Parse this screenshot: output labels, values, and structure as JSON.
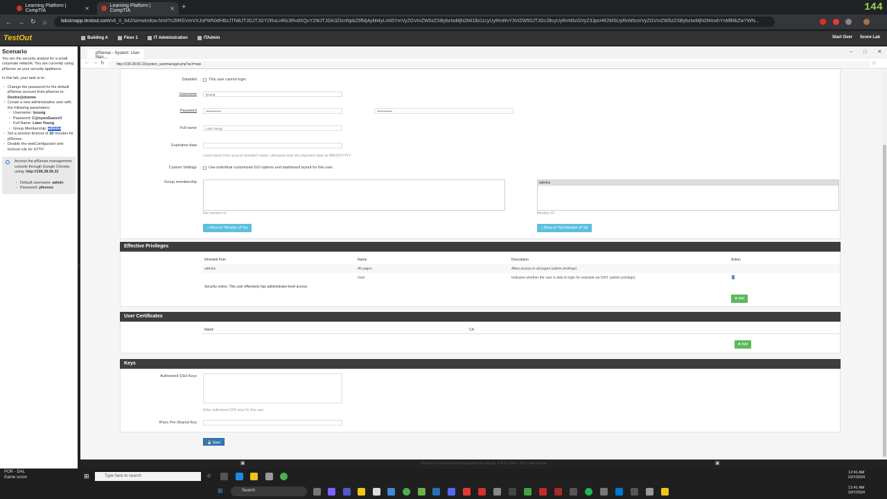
{
  "browser": {
    "tabs": [
      {
        "label": "Learning Platform | CompTIA"
      },
      {
        "label": "Learning Platform | CompTIA"
      }
    ],
    "url_domain": "labsimapp.testout.com",
    "url_rest": "/v6_0_642/simwindow.html?c2ltRGVmVXJsPWh0dHBzJTNBJTJGJTJGY2RuLnRic3RvdXQuY29tJTJGK3ZicnNpb25fMjAyMi4yLnN5YmVyZGVmZW5zZXBybzIwMjN2Mi1lbi11cyUyRmRvY3VtZW50JTJGc2ltcyUyRnN5cGVyZ3JpcHR2MSUyRnN5cmVyZGVmZW5zZXBybzIwMjN2MmxhYnMlMkZwYWN...",
    "game_score": "144"
  },
  "toolbar": {
    "logo": "TestOut",
    "items": [
      {
        "label": "Building A",
        "icon": "building-icon"
      },
      {
        "label": "Floor 1",
        "icon": "floor-icon"
      },
      {
        "label": "IT Administration",
        "icon": "room-icon"
      },
      {
        "label": "ITAdmin",
        "icon": "computer-icon"
      }
    ],
    "start_over": "Start Over",
    "score_lab": "Score Lab"
  },
  "scenario": {
    "title": "Scenario",
    "intro": "You are the security analyst for a small corporate network. You are currently using pfSense as your security appliance.",
    "task_intro": "In this lab, your task is to:",
    "task1_a": "Change the password for the default pfSense account from pfsense to: ",
    "task1_b": "Dontre@donme",
    "task2": "Create a new administrative user with the following parameters:",
    "p_user_l": "Username: ",
    "p_user_v": "lyoung",
    "p_pass_l": "Password: ",
    "p_pass_v": "C@nyouGuess!t",
    "p_full_l": "Full Name: ",
    "p_full_v": "Liam Young",
    "p_grp_l": "Group Membership: ",
    "p_grp_v": "admins",
    "task3_a": "Set a session timeout of ",
    "task3_b": "20",
    "task3_c": " minutes for pfSense.",
    "task4": "Disable the webConfigurator anti-lockout rule for HTTP.",
    "info_a": "Access the pfSense management console through Google Chrome using: ",
    "info_b": "http://198.28.56.22",
    "def_user_l": "Default username: ",
    "def_user_v": "admin",
    "def_pass_l": "Password: ",
    "def_pass_v": "pfsense"
  },
  "inner_window": {
    "title": "pfSense - System: User Man...",
    "url": "http://198.28.56.22/system_usermanager.php?act=new"
  },
  "form": {
    "disabled_label": "Disabled",
    "disabled_text": "This user cannot login",
    "username_label": "Username",
    "username_value": "lyoung",
    "password_label": "Password",
    "password_value": "••••••••••••••",
    "password_confirm": "••••••••••••••",
    "fullname_label": "Full name",
    "fullname_value": "Liam Young",
    "expiration_label": "Expiration data",
    "expiration_hint": "Leave blank if the account shouldn't expire, otherwise enter the expiration date as MM/DD/YYYY",
    "custom_label": "Custom Settings",
    "custom_text": "Use individual customized GUI options and dashboard layout for this user.",
    "group_label": "Group membership",
    "not_member_caption": "Not member of",
    "member_caption": "Member Of",
    "member_item": "admins",
    "move_to_member": "Move to \"Member of\" list",
    "move_to_not_member": "Move to \"Not Member of\" list"
  },
  "privileges": {
    "title": "Effective Privileges",
    "headers": [
      "Inherited from",
      "Name",
      "Description",
      "Action"
    ],
    "rows": [
      {
        "from": "admins",
        "name": "All pages",
        "desc": "Allow access to all pages (admin privilege)"
      },
      {
        "from": "",
        "name": "User",
        "desc": "Indicates whether the user is able to login for example via SSH. (admin privilege)"
      }
    ],
    "notice": "Security notice: This user effectively has administrator-level access",
    "add": "Add"
  },
  "certificates": {
    "title": "User Certificates",
    "headers": [
      "Name",
      "CA"
    ],
    "add": "Add"
  },
  "keys": {
    "title": "Keys",
    "ssh_label": "Authorized SSH Keys",
    "ssh_hint": "Enter authorized SSH keys for this user",
    "ipsec_label": "IPsec Pre-Shared Key",
    "save": "Save"
  },
  "footer": "pfSense is developed and maintained by netgate. © ESF 2004 - 2020 view license",
  "taskbar": {
    "game_title": "POR - DAL",
    "game_sub": "Game score",
    "search_placeholder": "Type here to search",
    "search2": "Search",
    "time": "12:41 AM",
    "date": "10/7/2024"
  }
}
